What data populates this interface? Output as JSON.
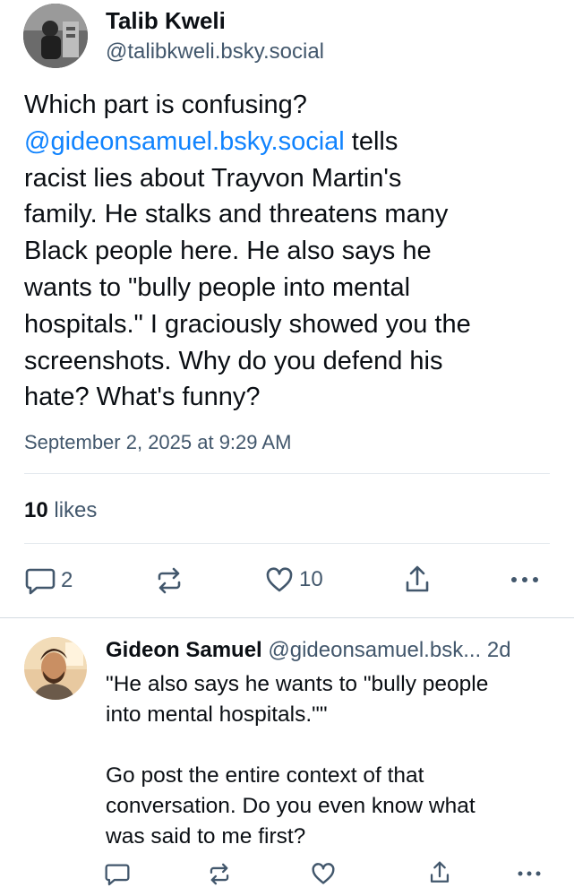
{
  "post": {
    "author_name": "Talib Kweli",
    "author_handle": "@talibkweli.bsky.social",
    "mention": "@gideonsamuel.bsky.social",
    "text_lines": [
      "Which part is confusing?",
      " tells",
      "racist lies about Trayvon Martin's",
      "family. He stalks and threatens many",
      "Black people here. He also says he",
      "wants to \"bully people into mental",
      "hospitals.\" I graciously showed you the",
      "screenshots. Why do you defend his",
      "hate? What's funny?"
    ],
    "timestamp": "September 2, 2025 at 9:29 AM",
    "likes_count": "10",
    "likes_label": " likes",
    "reply_count": "2",
    "like_count": "10"
  },
  "reply": {
    "author_name": "Gideon Samuel",
    "author_handle": "@gideonsamuel.bsk...",
    "age": "2d",
    "lines": [
      "\"He also says he wants to \"bully people",
      "into mental hospitals.\"\"",
      "",
      "Go post the entire context of that",
      "conversation.  Do you even know what",
      "was said to me first?"
    ]
  },
  "icons": {
    "reply": "reply-bubble-icon",
    "repost": "repost-icon",
    "like": "heart-icon",
    "share": "share-icon",
    "more": "more-dots-icon"
  },
  "colors": {
    "link": "#1083fe",
    "muted": "#42576c",
    "divider": "#e4e9ee"
  }
}
